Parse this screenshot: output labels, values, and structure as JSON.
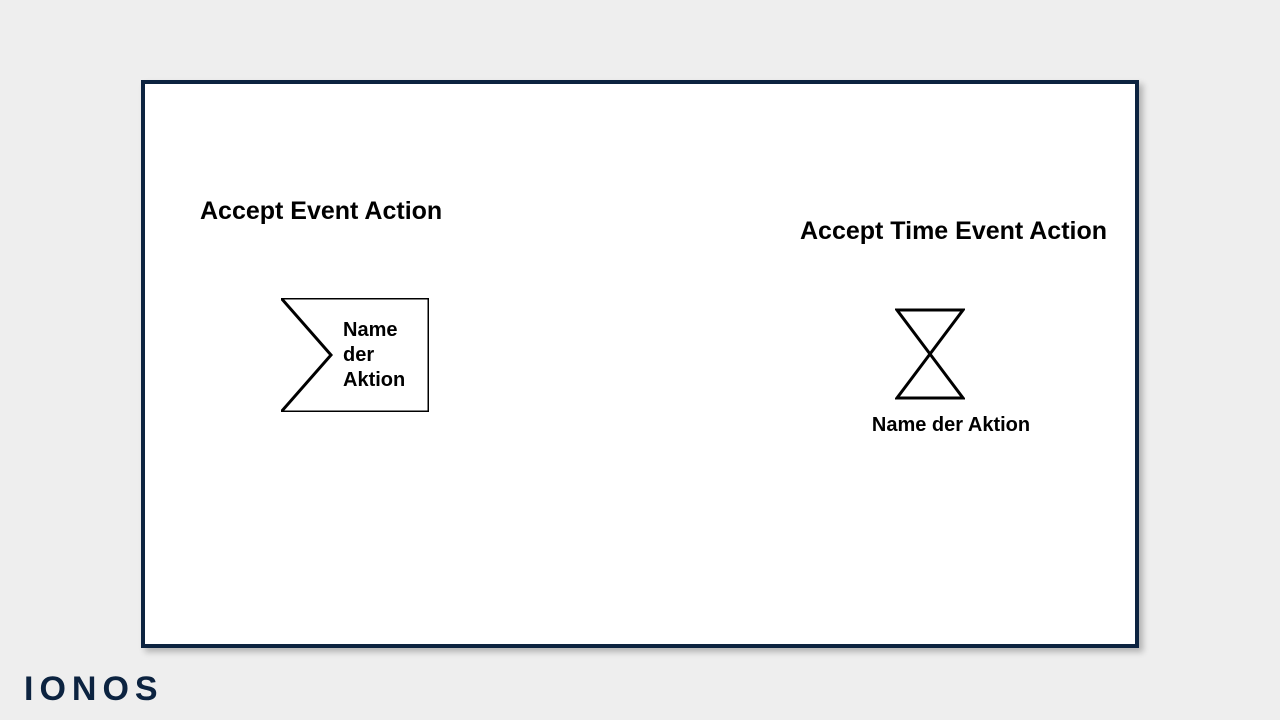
{
  "headings": {
    "left": "Accept Event Action",
    "right": "Accept Time Event Action"
  },
  "labels": {
    "event_line1": "Name",
    "event_line2": "der",
    "event_line3": "Aktion",
    "time_caption": "Name der Aktion"
  },
  "brand": "IONOS"
}
